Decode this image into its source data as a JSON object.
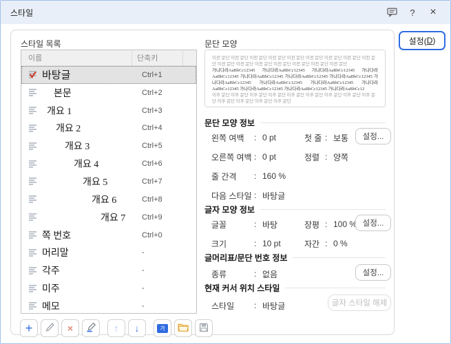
{
  "colors": {
    "accent_blue": "#2e6be0",
    "check_red": "#d0341c",
    "titlebar_bg": "#e9eff9"
  },
  "ui": {
    "colon": ":"
  },
  "titlebar": {
    "title": "스타일",
    "help_glyph": "?",
    "close_glyph": "×"
  },
  "settings_button": {
    "prefix": "설정(",
    "key": "D",
    "suffix": ")"
  },
  "style_list": {
    "label": "스타일 목록",
    "header": {
      "name": "이름",
      "shortcut": "단축키"
    },
    "rows": [
      {
        "name": "바탕글",
        "shortcut": "Ctrl+1",
        "indent": 0,
        "selected": true,
        "checked": true
      },
      {
        "name": "본문",
        "shortcut": "Ctrl+2",
        "indent": 17,
        "selected": false,
        "checked": false
      },
      {
        "name": "개요 1",
        "shortcut": "Ctrl+3",
        "indent": 7,
        "selected": false,
        "checked": false
      },
      {
        "name": "개요 2",
        "shortcut": "Ctrl+4",
        "indent": 20,
        "selected": false,
        "checked": false
      },
      {
        "name": "개요 3",
        "shortcut": "Ctrl+5",
        "indent": 33,
        "selected": false,
        "checked": false
      },
      {
        "name": "개요 4",
        "shortcut": "Ctrl+6",
        "indent": 46,
        "selected": false,
        "checked": false
      },
      {
        "name": "개요 5",
        "shortcut": "Ctrl+7",
        "indent": 59,
        "selected": false,
        "checked": false
      },
      {
        "name": "개요 6",
        "shortcut": "Ctrl+8",
        "indent": 72,
        "selected": false,
        "checked": false
      },
      {
        "name": "개요 7",
        "shortcut": "Ctrl+9",
        "indent": 85,
        "selected": false,
        "checked": false
      },
      {
        "name": "쪽 번호",
        "shortcut": "Ctrl+0",
        "indent": 0,
        "selected": false,
        "checked": false
      },
      {
        "name": "머리말",
        "shortcut": "-",
        "indent": 0,
        "selected": false,
        "checked": false
      },
      {
        "name": "각주",
        "shortcut": "-",
        "indent": 0,
        "selected": false,
        "checked": false
      },
      {
        "name": "미주",
        "shortcut": "-",
        "indent": 0,
        "selected": false,
        "checked": false
      },
      {
        "name": "메모",
        "shortcut": "-",
        "indent": 0,
        "selected": false,
        "checked": false
      }
    ]
  },
  "toolbar": {
    "buttons": [
      {
        "name": "add-style-button",
        "icon": "plus-icon",
        "glyph": "+"
      },
      {
        "name": "edit-style-button",
        "icon": "pencil-icon"
      },
      {
        "name": "delete-style-button",
        "icon": "x-icon",
        "glyph": "×"
      },
      {
        "name": "char-style-button",
        "icon": "pen-icon"
      },
      {
        "name": "move-up-button",
        "icon": "up-arrow-icon",
        "glyph": "↑"
      },
      {
        "name": "move-down-button",
        "icon": "down-arrow-icon",
        "glyph": "↓"
      },
      {
        "name": "style-gallery-button",
        "icon": "style-template-icon",
        "glyph": "가"
      },
      {
        "name": "import-style-button",
        "icon": "open-folder-icon"
      },
      {
        "name": "export-style-button",
        "icon": "save-disk-icon"
      }
    ]
  },
  "preview": {
    "label": "문단 모양",
    "before": "이전 문단 이전 문단 이전 문단 이전 문단 이전 문단 이전 문단 이전 문단 이전 문단 이전 문단 이전 문단 이전 문단 이전 문단 이전 문단 이전 문단 이전 문단 이전 문단",
    "sample": "가나다라AaBbCc12345 가나다라AaBbCc12345 가나다라AaBbCc12345 가나다라AaBbCc12345 가나다라AaBbCc12345 가나다라AaBbCc12345 가나다라AaBbCc12345 가나다라AaBbCc12345 가나다라AaBbCc12345 가나다라AaBbCc12345 가나다라AaBbCc12345 가나다라AaBbCc12345 가나다라AaBbCc12345 가나다라AaBbCc12",
    "after": "이후 문단 이후 문단 이후 문단 이후 문단 이후 문단 이후 문단 이후 문단 이후 문단 이후 문단 이후 문단 이후 문단 이후 문단 이후 문단"
  },
  "paragraph_info": {
    "title": "문단 모양 정보",
    "left_margin_label": "왼쪽 여백",
    "left_margin_value": "0 pt",
    "first_line_label": "첫 줄",
    "first_line_value": "보통",
    "right_margin_label": "오른쪽 여백",
    "right_margin_value": "0 pt",
    "align_label": "정렬",
    "align_value": "양쪽",
    "line_spacing_label": "줄 간격",
    "line_spacing_value": "160 %",
    "next_style_label": "다음 스타일",
    "next_style_value": "바탕글",
    "settings_label": "설정..."
  },
  "char_info": {
    "title": "글자 모양 정보",
    "font_label": "글꼴",
    "font_value": "바탕",
    "width_label": "장평",
    "width_value": "100 %",
    "size_label": "크기",
    "size_value": "10 pt",
    "spacing_label": "자간",
    "spacing_value": "0 %",
    "settings_label": "설정..."
  },
  "bullet_info": {
    "title": "글머리표/문단 번호 정보",
    "type_label": "종류",
    "type_value": "없음",
    "settings_label": "설정..."
  },
  "cursor_info": {
    "title": "현재 커서 위치 스타일",
    "style_label": "스타일",
    "style_value": "바탕글",
    "release_button": "글자 스타일 해제"
  }
}
